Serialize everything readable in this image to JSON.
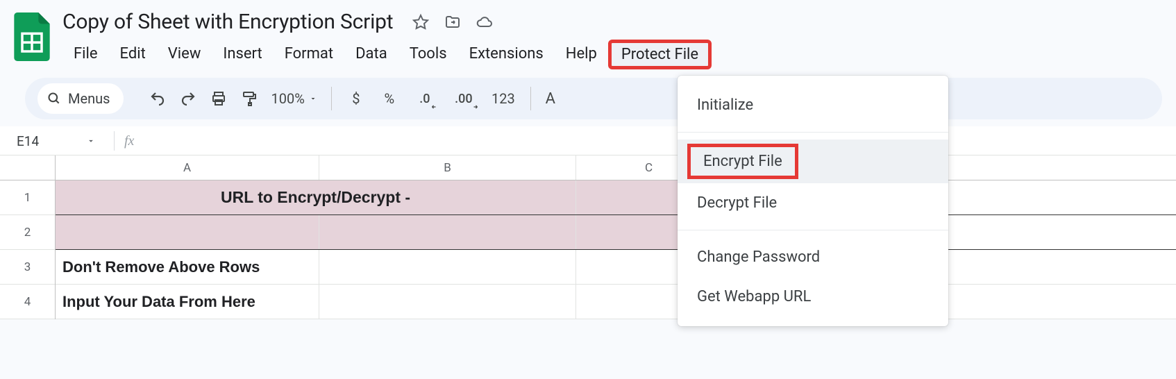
{
  "doc": {
    "title": "Copy of Sheet with Encryption Script"
  },
  "menubar": {
    "items": [
      "File",
      "Edit",
      "View",
      "Insert",
      "Format",
      "Data",
      "Tools",
      "Extensions",
      "Help",
      "Protect File"
    ]
  },
  "toolbar": {
    "menus_label": "Menus",
    "zoom": "100%",
    "currency": "$",
    "percent": "%",
    "dec_dec": ".0",
    "inc_dec": ".00",
    "num_format": "123",
    "font_initial": "A"
  },
  "namebox": {
    "cell_ref": "E14",
    "fx": "fx"
  },
  "grid": {
    "col_headers": [
      "A",
      "B",
      "C"
    ],
    "row_headers": [
      "1",
      "2",
      "3",
      "4"
    ],
    "row1_merged": "URL to Encrypt/Decrypt -",
    "row3_a": "Don't Remove Above Rows",
    "row4_a": "Input Your Data From Here"
  },
  "dropdown": {
    "items": [
      "Initialize",
      "Encrypt File",
      "Decrypt File",
      "Change Password",
      "Get Webapp URL"
    ]
  }
}
